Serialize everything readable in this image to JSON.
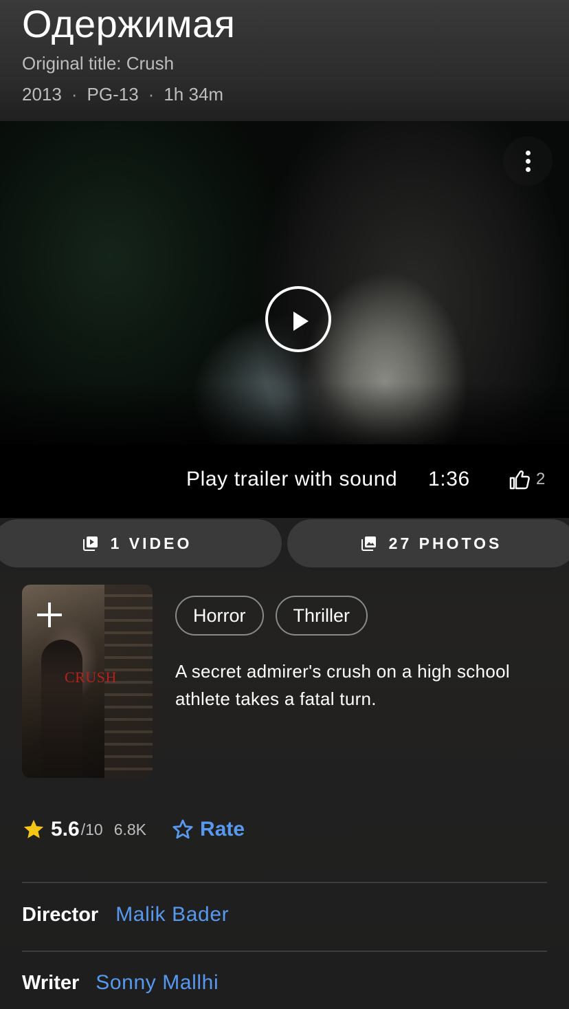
{
  "header": {
    "title": "Одержимая",
    "original_title": "Original title: Crush",
    "year": "2013",
    "rating": "PG-13",
    "runtime": "1h 34m",
    "separator": "·"
  },
  "trailer": {
    "label": "Play trailer with sound",
    "duration": "1:36",
    "likes": "2",
    "more_icon": "more-vert-icon",
    "play_icon": "play-circle-icon",
    "like_icon": "thumbs-up-icon"
  },
  "media": {
    "videos_label": "1 VIDEO",
    "photos_label": "27 PHOTOS",
    "video_icon": "video-library-icon",
    "photo_icon": "photo-library-icon"
  },
  "poster": {
    "logo_text": "CRUSH",
    "add_icon": "plus-icon"
  },
  "genres": [
    "Horror",
    "Thriller"
  ],
  "plot": "A secret admirer's crush on a high school athlete takes a fatal turn.",
  "rating": {
    "value": "5.6",
    "max": "/10",
    "count": "6.8K",
    "rate_label": "Rate",
    "star_color": "#f5c518",
    "accent_color": "#5799ef"
  },
  "credits": [
    {
      "role": "Director",
      "name": "Malik Bader"
    },
    {
      "role": "Writer",
      "name": "Sonny Mallhi"
    }
  ]
}
